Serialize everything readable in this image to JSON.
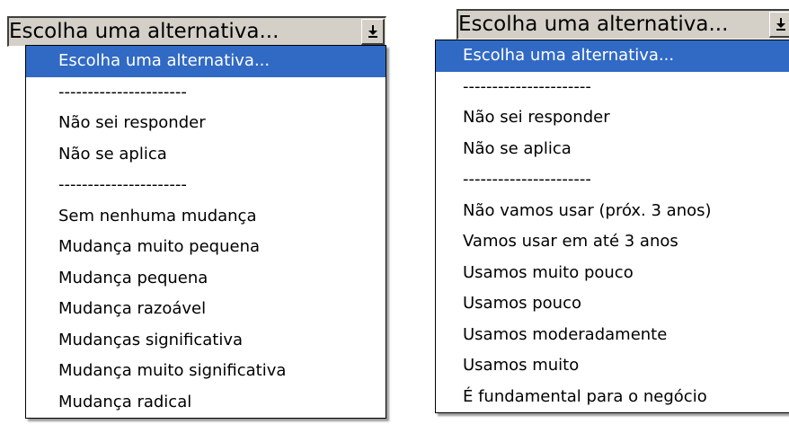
{
  "left_select": {
    "value": "Escolha uma alternativa...",
    "options": [
      "Escolha uma alternativa...",
      "----------------------",
      "Não sei responder",
      "Não se aplica",
      "----------------------",
      "Sem nenhuma mudança",
      "Mudança muito pequena",
      "Mudança pequena",
      "Mudança razoável",
      "Mudanças significativa",
      "Mudança muito significativa",
      "Mudança radical"
    ],
    "highlighted_index": 0
  },
  "right_select": {
    "value": "Escolha uma alternativa...",
    "options": [
      "Escolha uma alternativa...",
      "----------------------",
      "Não sei responder",
      "Não se aplica",
      "----------------------",
      "Não vamos usar (próx. 3 anos)",
      "Vamos usar em até 3 anos",
      "Usamos muito pouco",
      "Usamos pouco",
      "Usamos moderadamente",
      "Usamos muito",
      "É fundamental para o negócio"
    ],
    "highlighted_index": 0
  },
  "colors": {
    "highlight": "#316ac5",
    "control_face": "#d4d0c8"
  },
  "icons": {
    "dropdown_arrow": "arrow-down-to-line-icon"
  }
}
